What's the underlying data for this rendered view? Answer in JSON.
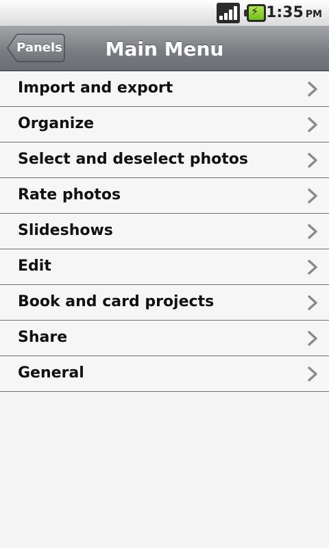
{
  "status_bar": {
    "signal_icon": "signal-icon",
    "battery_icon": "battery-charging-icon",
    "time": "1:35",
    "ampm": "PM"
  },
  "header": {
    "back_label": "Panels",
    "title": "Main Menu",
    "colors": {
      "bar_top": "#a3a6a8",
      "bar_bottom": "#6a6e72",
      "text": "#ffffff"
    }
  },
  "menu": {
    "items": [
      {
        "label": "Import and export"
      },
      {
        "label": "Organize"
      },
      {
        "label": "Select and deselect photos"
      },
      {
        "label": "Rate photos"
      },
      {
        "label": "Slideshows"
      },
      {
        "label": "Edit"
      },
      {
        "label": "Book and card projects"
      },
      {
        "label": "Share"
      },
      {
        "label": "General"
      }
    ],
    "chevron_icon": "chevron-right-icon",
    "colors": {
      "background": "#f6f6f6",
      "divider": "#6e6e6e",
      "chevron": "#8a8a8a"
    }
  }
}
